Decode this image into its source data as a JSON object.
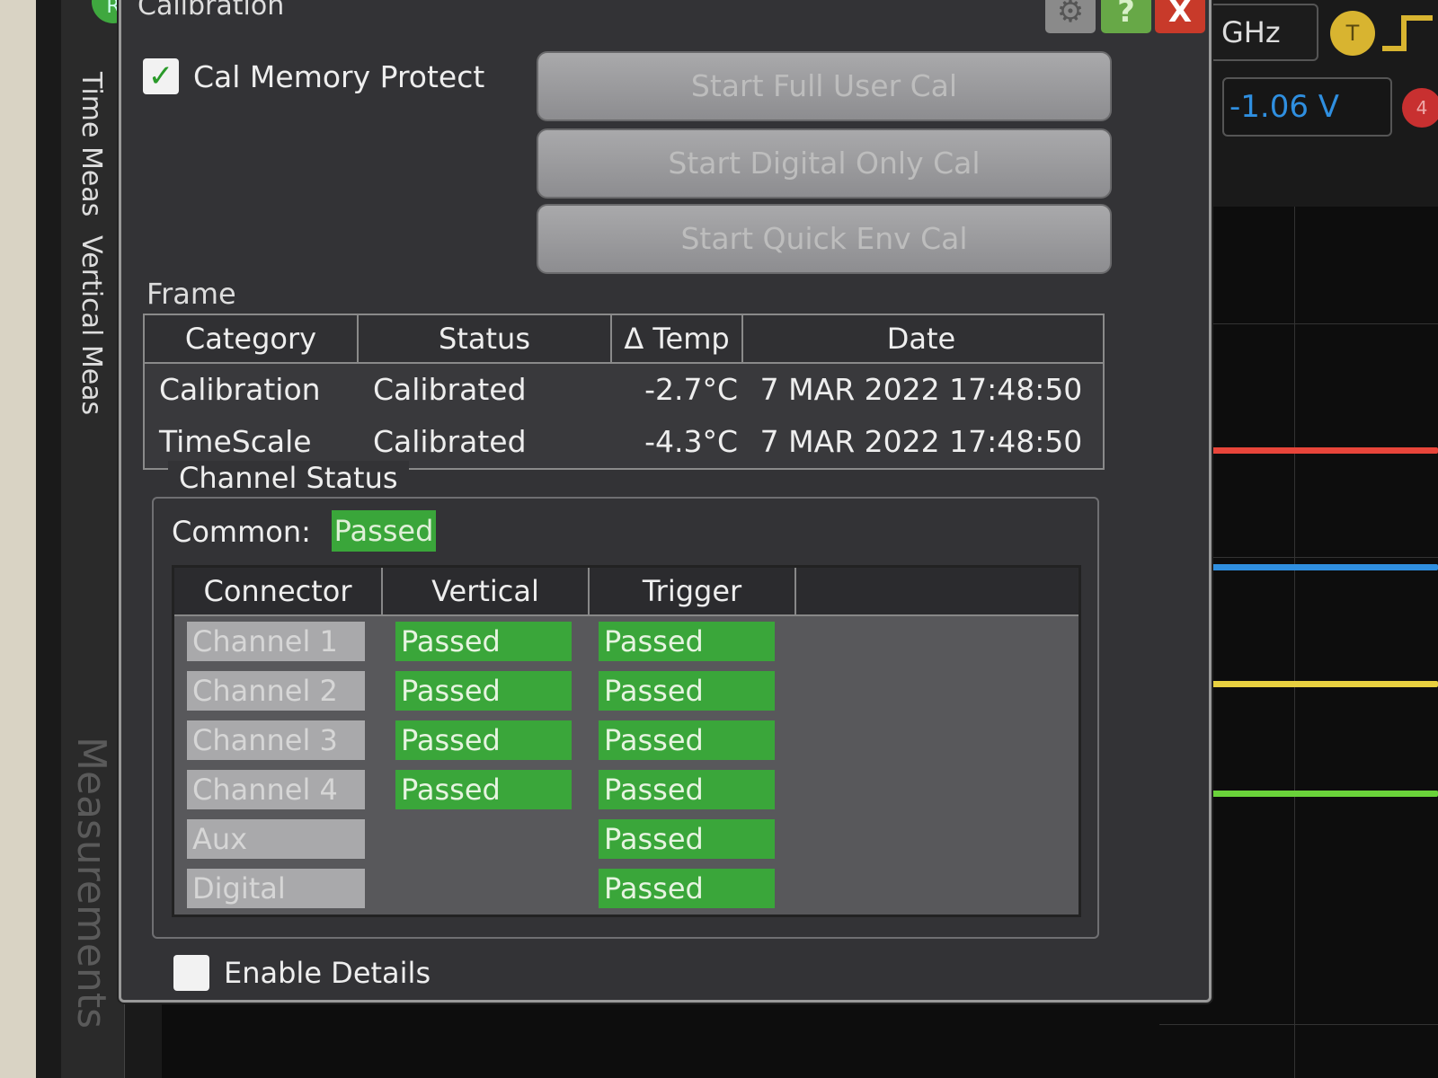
{
  "window": {
    "title": "Calibration",
    "settings_icon": "gear-icon",
    "help_label": "?",
    "close_label": "X"
  },
  "side_tabs": {
    "run_label": "R",
    "items": [
      "Time Meas",
      "Vertical Meas",
      "Measurements"
    ]
  },
  "top_controls": {
    "bandwidth_unit": "GHz",
    "trigger_badge": "T",
    "trigger_level": "-1.06 V",
    "channel_badge": "4"
  },
  "cal_memory_protect": {
    "label": "Cal Memory Protect",
    "checked": true
  },
  "buttons": {
    "full_user_cal": "Start Full User Cal",
    "digital_only_cal": "Start Digital Only Cal",
    "quick_env_cal": "Start Quick Env Cal"
  },
  "frame": {
    "label": "Frame",
    "headers": [
      "Category",
      "Status",
      "Δ Temp",
      "Date"
    ],
    "rows": [
      [
        "Calibration",
        "Calibrated",
        "-2.7°C",
        "7 MAR 2022 17:48:50"
      ],
      [
        "TimeScale",
        "Calibrated",
        "-4.3°C",
        "7 MAR 2022 17:48:50"
      ]
    ]
  },
  "channel_status": {
    "title": "Channel Status",
    "common_label": "Common:",
    "common_value": "Passed",
    "headers": [
      "Connector",
      "Vertical",
      "Trigger",
      ""
    ],
    "rows": [
      {
        "connector": "Channel 1",
        "vertical": "Passed",
        "trigger": "Passed"
      },
      {
        "connector": "Channel 2",
        "vertical": "Passed",
        "trigger": "Passed"
      },
      {
        "connector": "Channel 3",
        "vertical": "Passed",
        "trigger": "Passed"
      },
      {
        "connector": "Channel 4",
        "vertical": "Passed",
        "trigger": "Passed"
      },
      {
        "connector": "Aux",
        "vertical": "",
        "trigger": "Passed"
      },
      {
        "connector": "Digital",
        "vertical": "",
        "trigger": "Passed"
      }
    ]
  },
  "enable_details": {
    "label": "Enable Details",
    "checked": false
  },
  "colors": {
    "passed": "#3aa63a",
    "trace_ch1": "#e8453a",
    "trace_ch2": "#2f8fe0",
    "trace_ch3": "#e8d040",
    "trace_ch4": "#6ad23a"
  }
}
